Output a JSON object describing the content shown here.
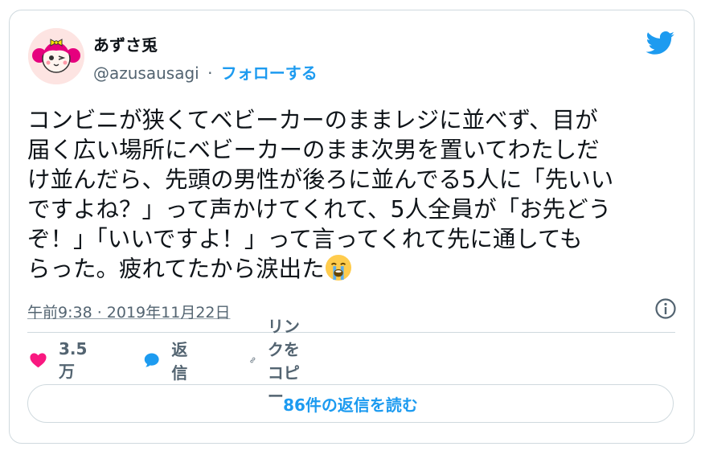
{
  "author": {
    "name": "あずさ兎",
    "handle": "@azusausagi",
    "separator": "·",
    "follow_label": "フォローする"
  },
  "tweet": {
    "text": "コンビニが狭くてベビーカーのままレジに並べず、目が\n届く広い場所にベビーカーのまま次男を置いてわたしだ\nけ並んだら、先頭の男性が後ろに並んでる5人に「先いい\nですよね？」って声かけてくれて、5人全員が「お先どう\nぞ！」「いいですよ！」って言ってくれて先に通しても\nらった。疲れてたから涙出た",
    "emoji": "loudly-crying-face",
    "timestamp": "午前9:38 · 2019年11月22日"
  },
  "actions": {
    "like_count": "3.5万",
    "reply_label": "返信",
    "copy_link_label": "リンクをコピー"
  },
  "read_replies_label": "86件の返信を読む",
  "colors": {
    "accent": "#1d9bf0",
    "like": "#f91880",
    "secondary_text": "#536471",
    "border": "#cfd9de"
  }
}
